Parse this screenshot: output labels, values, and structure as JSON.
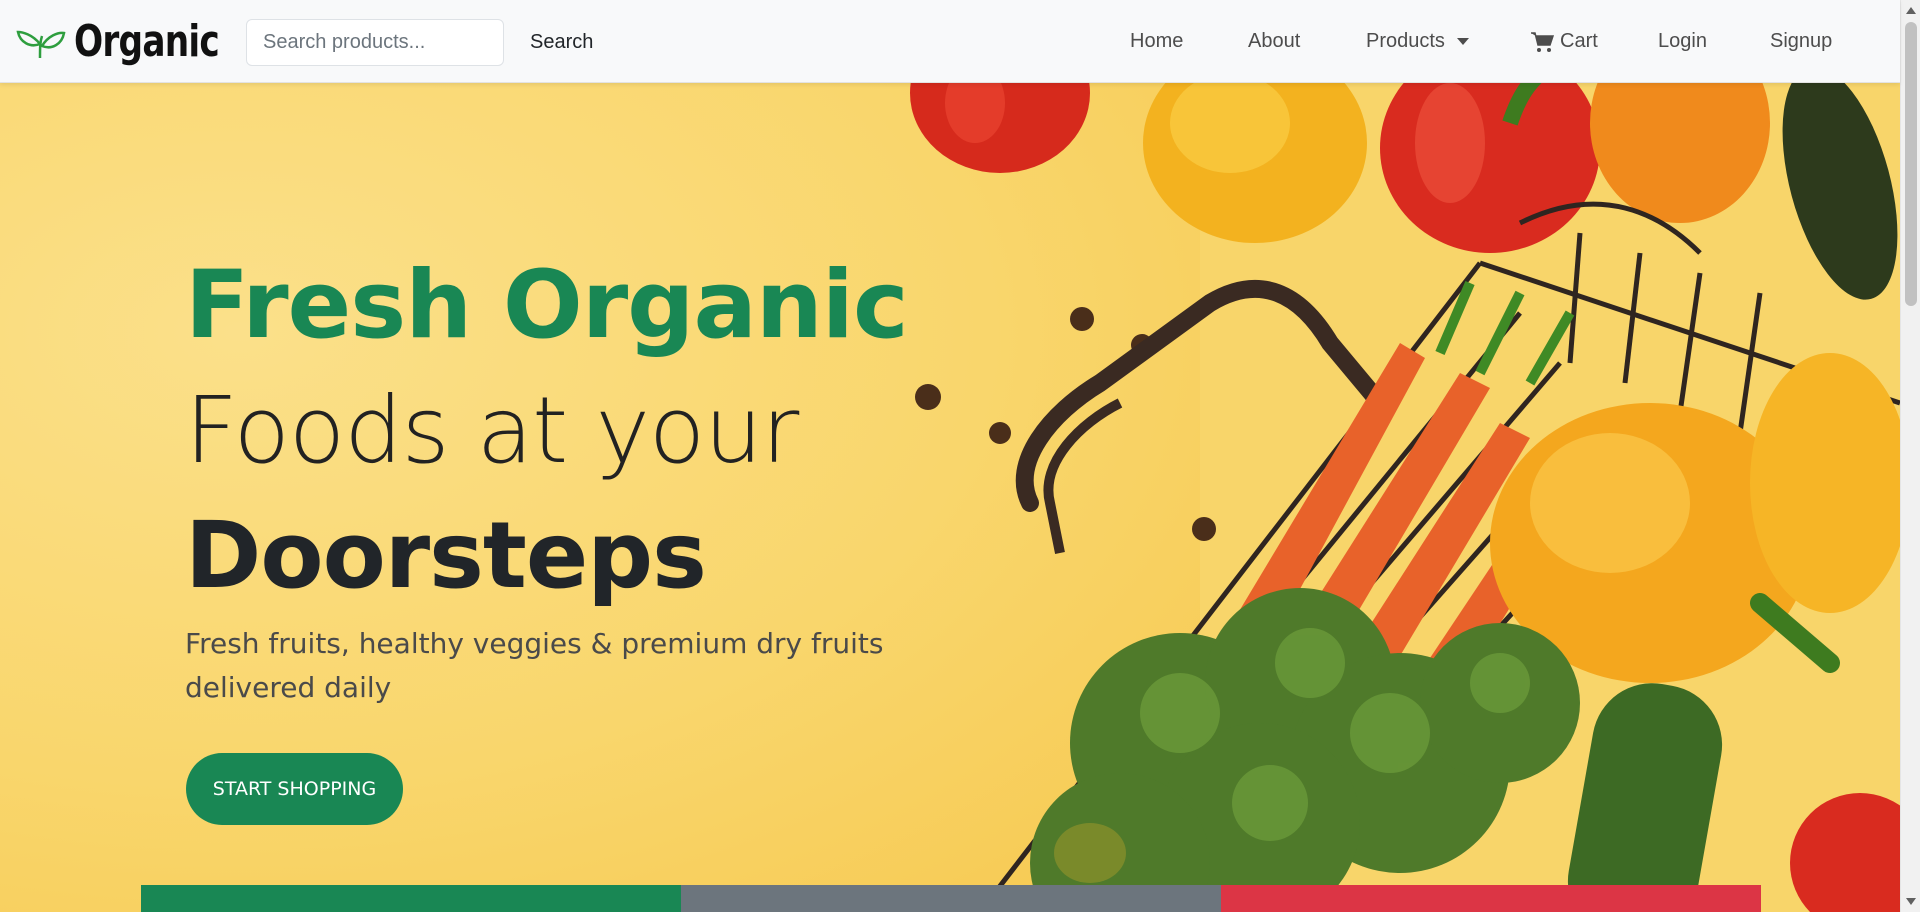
{
  "brand": {
    "name": "Organic",
    "icon": "leaf-sprout-icon",
    "icon_color": "#2e9e3e"
  },
  "search": {
    "placeholder": "Search products...",
    "button_label": "Search"
  },
  "nav": {
    "home": "Home",
    "about": "About",
    "products": "Products",
    "cart": "Cart",
    "login": "Login",
    "signup": "Signup",
    "cart_icon": "shopping-cart-icon",
    "products_icon": "caret-down-icon"
  },
  "hero": {
    "line1": "Fresh Organic",
    "line2": "Foods at your",
    "line3": "Doorsteps",
    "subtext": "Fresh fruits, healthy veggies & premium dry fruits delivered daily",
    "cta_label": "START SHOPPING",
    "background_color": "#f8d56a",
    "accent_color": "#198754"
  },
  "color_strip": [
    "#198754",
    "#6c757d",
    "#dc3545"
  ]
}
